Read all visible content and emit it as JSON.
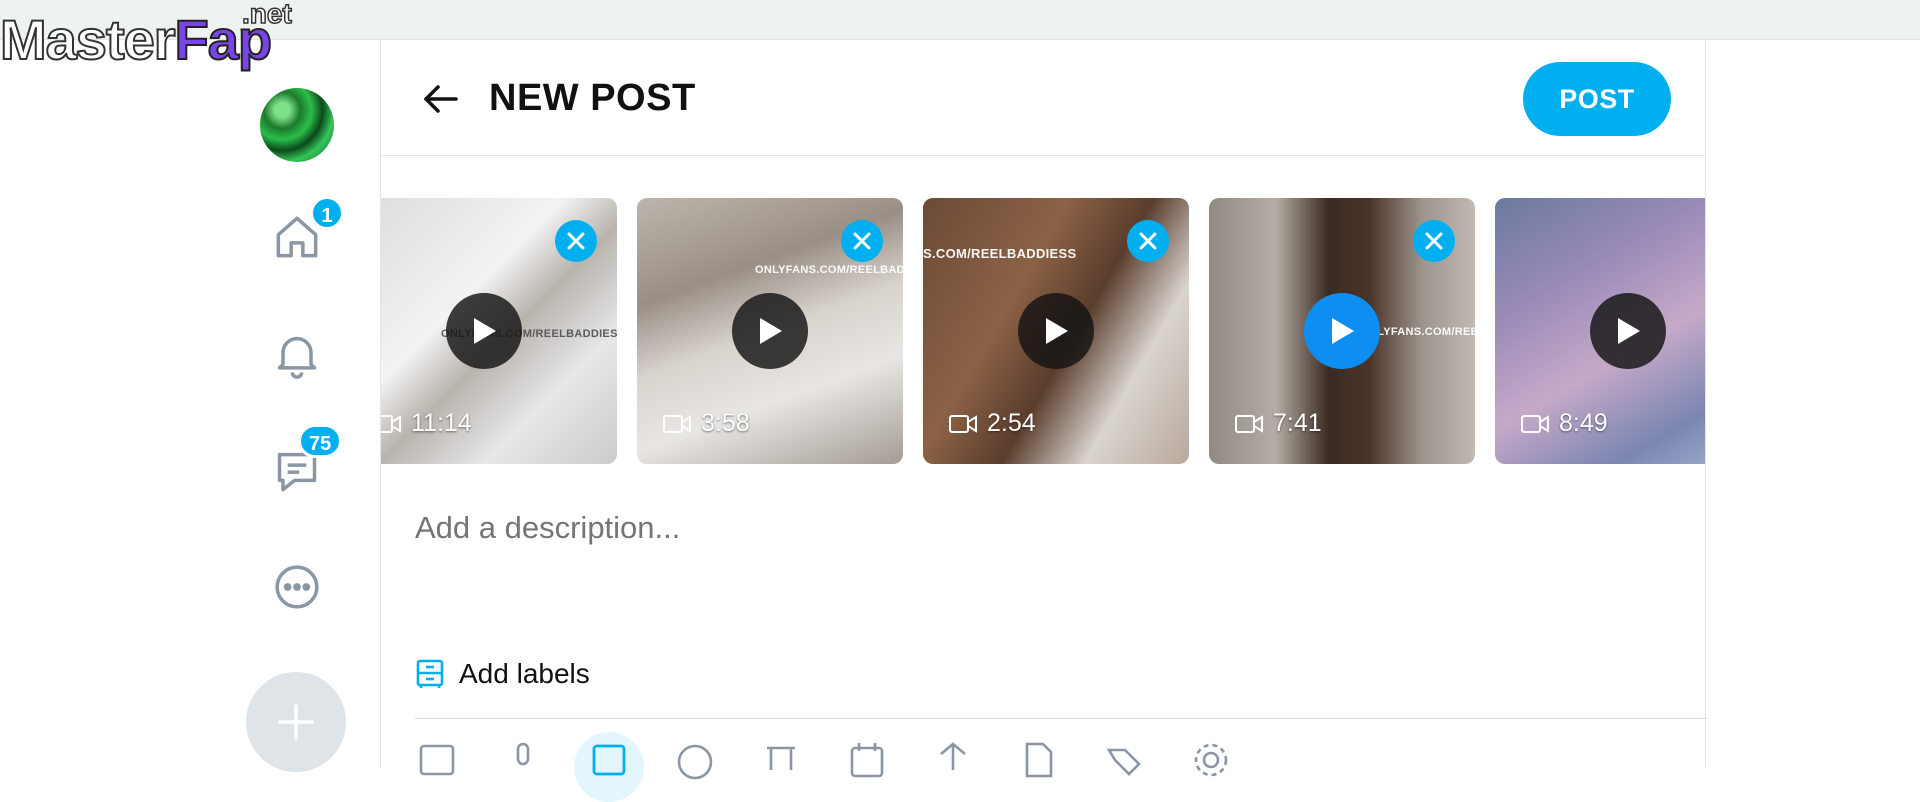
{
  "watermark": {
    "master": "Master",
    "fap": "Fap",
    "net": ".net"
  },
  "nav": {
    "home_badge": "1",
    "messages_badge": "75"
  },
  "header": {
    "title": "NEW POST",
    "post_label": "POST"
  },
  "media": [
    {
      "duration": "11:14",
      "watermark": "ONLYFANS.COM/REELBADDIESS"
    },
    {
      "duration": "3:58",
      "watermark": "ONLYFANS.COM/REELBADDIESS"
    },
    {
      "duration": "2:54",
      "watermark": "S.COM/REELBADDIESS"
    },
    {
      "duration": "7:41",
      "watermark": "NLYFANS.COM/REELBADDIESS"
    },
    {
      "duration": "8:49",
      "watermark": ""
    }
  ],
  "description": {
    "placeholder": "Add a description..."
  },
  "labels": {
    "text": "Add labels"
  },
  "colors": {
    "accent": "#00aff0",
    "text": "#111111",
    "muted": "#8a96a3"
  }
}
